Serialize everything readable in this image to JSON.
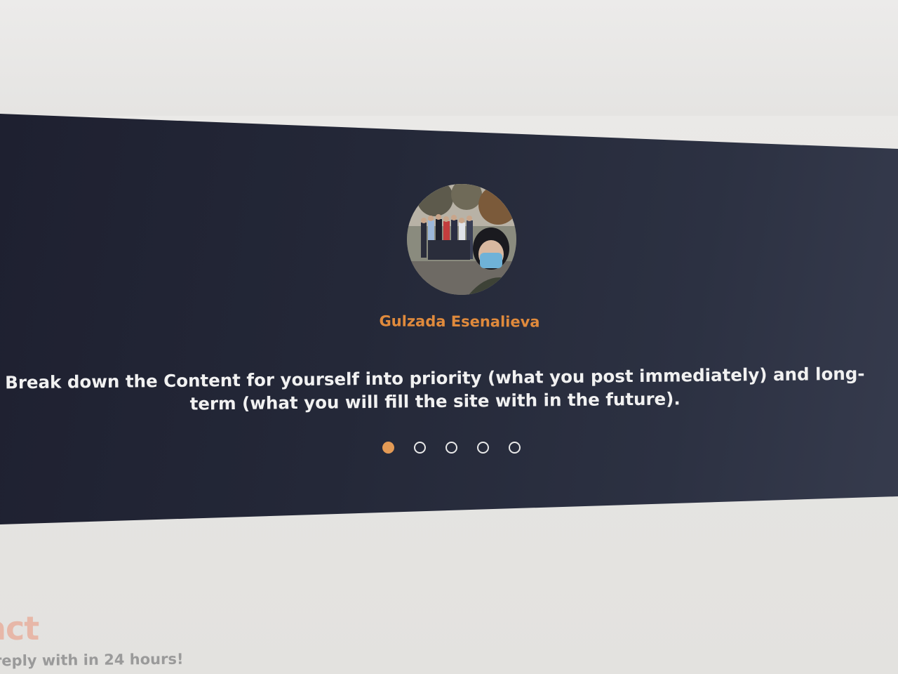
{
  "testimonial": {
    "name": "Gulzada Esenalieva",
    "quote": "Break down the Content for yourself into priority (what you post immediately) and long-term (what you will fill the site with in the future).",
    "avatar_icon": "user-photo-icon",
    "active_slide": 1,
    "slide_count": 5
  },
  "contact": {
    "heading": "act",
    "subtext": "reply with in 24 hours!"
  },
  "colors": {
    "accent": "#e08a3c",
    "band_background": "#242838",
    "quote_text": "#f1f1f1"
  }
}
